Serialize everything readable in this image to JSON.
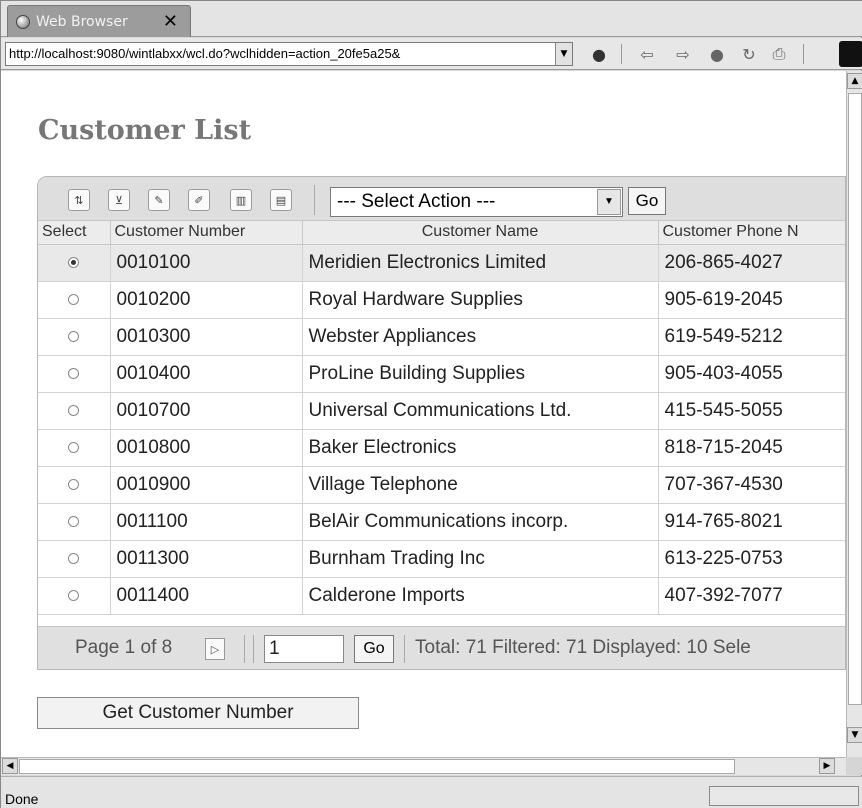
{
  "tab": {
    "title": "Web Browser",
    "close_symbol": "✕"
  },
  "address": {
    "url": "http://localhost:9080/wintlabxx/wcl.do?wclhidden=action_20fe5a25&"
  },
  "page": {
    "title": "Customer List"
  },
  "grid": {
    "action_select": "--- Select Action ---",
    "go_label": "Go",
    "columns": [
      "Select",
      "Customer Number",
      "Customer Name",
      "Customer Phone N"
    ],
    "rows": [
      {
        "number": "0010100",
        "name": "Meridien Electronics Limited",
        "phone": "206-865-4027",
        "selected": true
      },
      {
        "number": "0010200",
        "name": "Royal Hardware Supplies",
        "phone": "905-619-2045",
        "selected": false
      },
      {
        "number": "0010300",
        "name": "Webster Appliances",
        "phone": "619-549-5212",
        "selected": false
      },
      {
        "number": "0010400",
        "name": "ProLine Building Supplies",
        "phone": "905-403-4055",
        "selected": false
      },
      {
        "number": "0010700",
        "name": "Universal Communications Ltd.",
        "phone": "415-545-5055",
        "selected": false
      },
      {
        "number": "0010800",
        "name": "Baker Electronics",
        "phone": "818-715-2045",
        "selected": false
      },
      {
        "number": "0010900",
        "name": "Village Telephone",
        "phone": "707-367-4530",
        "selected": false
      },
      {
        "number": "0011100",
        "name": "BelAir Communications incorp.",
        "phone": "914-765-8021",
        "selected": false
      },
      {
        "number": "0011300",
        "name": "Burnham Trading Inc",
        "phone": "613-225-0753",
        "selected": false
      },
      {
        "number": "0011400",
        "name": "Calderone Imports",
        "phone": "407-392-7077",
        "selected": false
      }
    ],
    "pager": {
      "page_text": "Page 1 of 8",
      "page_input": "1",
      "go_label": "Go",
      "totals": "Total: 71 Filtered: 71 Displayed: 10 Sele"
    }
  },
  "get_button": "Get Customer Number",
  "status": {
    "text": "Done"
  }
}
